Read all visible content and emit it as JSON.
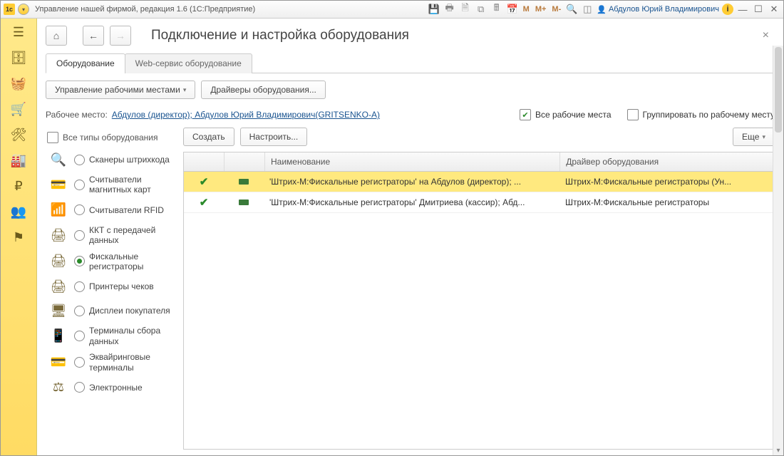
{
  "titlebar": {
    "title": "Управление нашей фирмой, редакция 1.6  (1С:Предприятие)",
    "m": "M",
    "mplus": "M+",
    "mminus": "M-",
    "user": "Абдулов Юрий Владимирович"
  },
  "page": {
    "title": "Подключение и настройка оборудования"
  },
  "tabs": [
    {
      "label": "Оборудование",
      "active": true
    },
    {
      "label": "Web-сервис оборудование",
      "active": false
    }
  ],
  "toolbar": {
    "workplaces": "Управление рабочими местами",
    "drivers": "Драйверы оборудования..."
  },
  "workplace": {
    "label": "Рабочее место:",
    "link": "Абдулов (директор); Абдулов Юрий Владимирович(GRITSENKO-A)",
    "all_checked": true,
    "all_label": "Все рабочие места",
    "group_checked": false,
    "group_label": "Группировать по рабочему месту"
  },
  "left": {
    "all_types": "Все типы оборудования",
    "items": [
      {
        "icon": "🔍",
        "label": "Сканеры штрихкода",
        "sel": false
      },
      {
        "icon": "💳",
        "label": "Считыватели магнитных карт",
        "sel": false
      },
      {
        "icon": "📶",
        "label": "Считыватели RFID",
        "sel": false
      },
      {
        "icon": "🖨",
        "label": "ККТ с передачей данных",
        "sel": false
      },
      {
        "icon": "🖨",
        "label": "Фискальные регистраторы",
        "sel": true
      },
      {
        "icon": "🖨",
        "label": "Принтеры чеков",
        "sel": false
      },
      {
        "icon": "🖥",
        "label": "Дисплеи покупателя",
        "sel": false
      },
      {
        "icon": "📱",
        "label": "Терминалы сбора данных",
        "sel": false
      },
      {
        "icon": "💳",
        "label": "Эквайринговые терминалы",
        "sel": false
      },
      {
        "icon": "⚖",
        "label": "Электронные",
        "sel": false
      }
    ]
  },
  "right": {
    "create": "Создать",
    "configure": "Настроить...",
    "more": "Еще",
    "columns": {
      "name": "Наименование",
      "driver": "Драйвер оборудования"
    },
    "rows": [
      {
        "sel": true,
        "check": true,
        "name": "'Штрих-М:Фискальные регистраторы' на Абдулов (директор); ...",
        "driver": "Штрих-М:Фискальные регистраторы (Ун..."
      },
      {
        "sel": false,
        "check": true,
        "name": "'Штрих-М:Фискальные регистраторы' Дмитриева (кассир); Абд...",
        "driver": "Штрих-М:Фискальные регистраторы"
      }
    ]
  }
}
